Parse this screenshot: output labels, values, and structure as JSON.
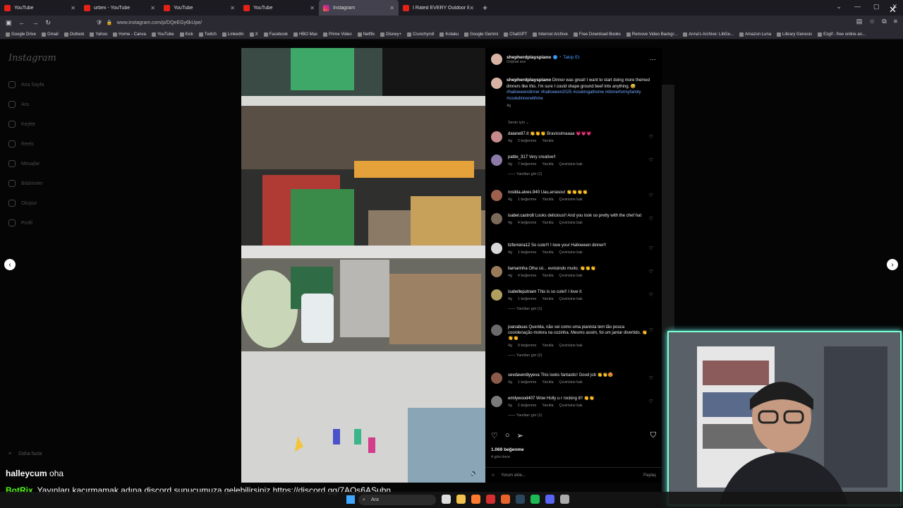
{
  "browser": {
    "tabs": [
      {
        "label": "YouTube",
        "icon": "youtube-icon",
        "active": false
      },
      {
        "label": "urbex - YouTube",
        "icon": "youtube-icon",
        "active": false
      },
      {
        "label": "YouTube",
        "icon": "youtube-icon",
        "active": false
      },
      {
        "label": "YouTube",
        "icon": "youtube-icon",
        "active": false
      },
      {
        "label": "Instagram",
        "icon": "instagram-icon",
        "active": true
      },
      {
        "label": "I Rated EVERY Outdoor Boys M...",
        "icon": "youtube-icon",
        "active": false
      }
    ],
    "url": "www.instagram.com/p/DQeEGy6kUpe/",
    "bookmarks": [
      "Google Drive",
      "Gmail",
      "Outlook",
      "Yahoo",
      "Home - Canva",
      "YouTube",
      "Kick",
      "Twitch",
      "LinkedIn",
      "X",
      "Facebook",
      "HBO Max",
      "Prime Video",
      "Netflix",
      "Disney+",
      "Crunchyroll",
      "Kotaku",
      "Google Gemini",
      "ChatGPT",
      "Internet Archive",
      "Free Download Books",
      "Remove Video Backgr...",
      "Anna's Archive: LibGe...",
      "Amazon Luna",
      "Library Genesis",
      "Ezgif - free online an..."
    ]
  },
  "instagram": {
    "logo": "Instagram",
    "sidebar": [
      "Ana Sayfa",
      "Ara",
      "Keşfet",
      "Reels",
      "Mesajlar",
      "Bildirimler",
      "Oluştur",
      "Profil"
    ],
    "more": "Daha fazla",
    "post": {
      "username": "shepherdplayspiano",
      "follow": "Takip Et",
      "audio": "Orijinal ses",
      "caption": "Dinner was great! I want to start doing more themed dinners like this. I'm sure I could shape ground beef into anything. 😅 ",
      "hashtags": "#halloweendinner #halloween2025 #cookingathome #dinnerformyfamily #cookdinnerwithme",
      "caption_age": "4g",
      "filter": "Senin için",
      "comments": [
        {
          "user": "daiane87.it",
          "text": "👏👏👏 Bravissimaaaa 💗💗💗",
          "age": "4g",
          "likes": "2 beğenme",
          "reply": "Yanıtla",
          "translate": "",
          "replies": ""
        },
        {
          "user": "pattie_317",
          "text": "Very creative!!",
          "age": "4g",
          "likes": "7 beğenme",
          "reply": "Yanıtla",
          "translate": "Çevirisine bak",
          "replies": "Yanıtları gör (1)"
        },
        {
          "user": "rosilda.alves.940",
          "text": "Uau,arrasou! 👏👏👏👏",
          "age": "4g",
          "likes": "1 beğenme",
          "reply": "Yanıtla",
          "translate": "Çevirisine bak",
          "replies": ""
        },
        {
          "user": "isabel.castro8",
          "text": "Looks delicious!! And you look so pretty with the chef hat",
          "age": "4g",
          "likes": "4 beğenme",
          "reply": "Yanıtla",
          "translate": "Çevirisine bak",
          "replies": ""
        },
        {
          "user": "lizferreira12",
          "text": "So cute!!! I love your Halloween dinner!!",
          "age": "4g",
          "likes": "1 beğenme",
          "reply": "Yanıtla",
          "translate": "Çevirisine bak",
          "replies": ""
        },
        {
          "user": "liamarinha",
          "text": "Olha só... evoluindo muito. 👏👏👏",
          "age": "4g",
          "likes": "4 beğenme",
          "reply": "Yanıtla",
          "translate": "Çevirisine bak",
          "replies": ""
        },
        {
          "user": "isabelleputnam",
          "text": "This is so cute!! I love it",
          "age": "4g",
          "likes": "1 beğenme",
          "reply": "Yanıtla",
          "translate": "Çevirisine bak",
          "replies": "Yanıtları gör (1)"
        },
        {
          "user": "joanabuas",
          "text": "Querida, não sei como uma pianista tem tão pouca coordenação motora na cozinha. Mesmo assim, foi um jantar divertido. 👏👏👏",
          "age": "4g",
          "likes": "9 beğenme",
          "reply": "Yanıtla",
          "translate": "Çevirisine bak",
          "replies": "Yanıtları gör (2)"
        },
        {
          "user": "sevdaverdiyyeva",
          "text": "This looks fantastic! Good job 👏👏😍",
          "age": "4g",
          "likes": "1 beğenme",
          "reply": "Yanıtla",
          "translate": "Çevirisine bak",
          "replies": ""
        },
        {
          "user": "emilywood407",
          "text": "Wow Holly u r rocking it!! 👏👏",
          "age": "4g",
          "likes": "2 beğenme",
          "reply": "Yanıtla",
          "translate": "Çevirisine bak",
          "replies": "Yanıtları gör (1)"
        }
      ],
      "like_count": "1.069 beğenme",
      "posted": "4 gün önce",
      "comment_placeholder": "Yorum ekle...",
      "share": "Paylaş"
    }
  },
  "overlay": {
    "chat_user1": "halleycum",
    "chat_msg1": "oha",
    "chat_user2": "BotRix",
    "chat_msg2": "Yayınları kaçırmamak adına discord sunucumuza gelebilirsiniz https://discord.gg/7AQs6ASubn"
  },
  "taskbar": {
    "search": "Ara"
  }
}
